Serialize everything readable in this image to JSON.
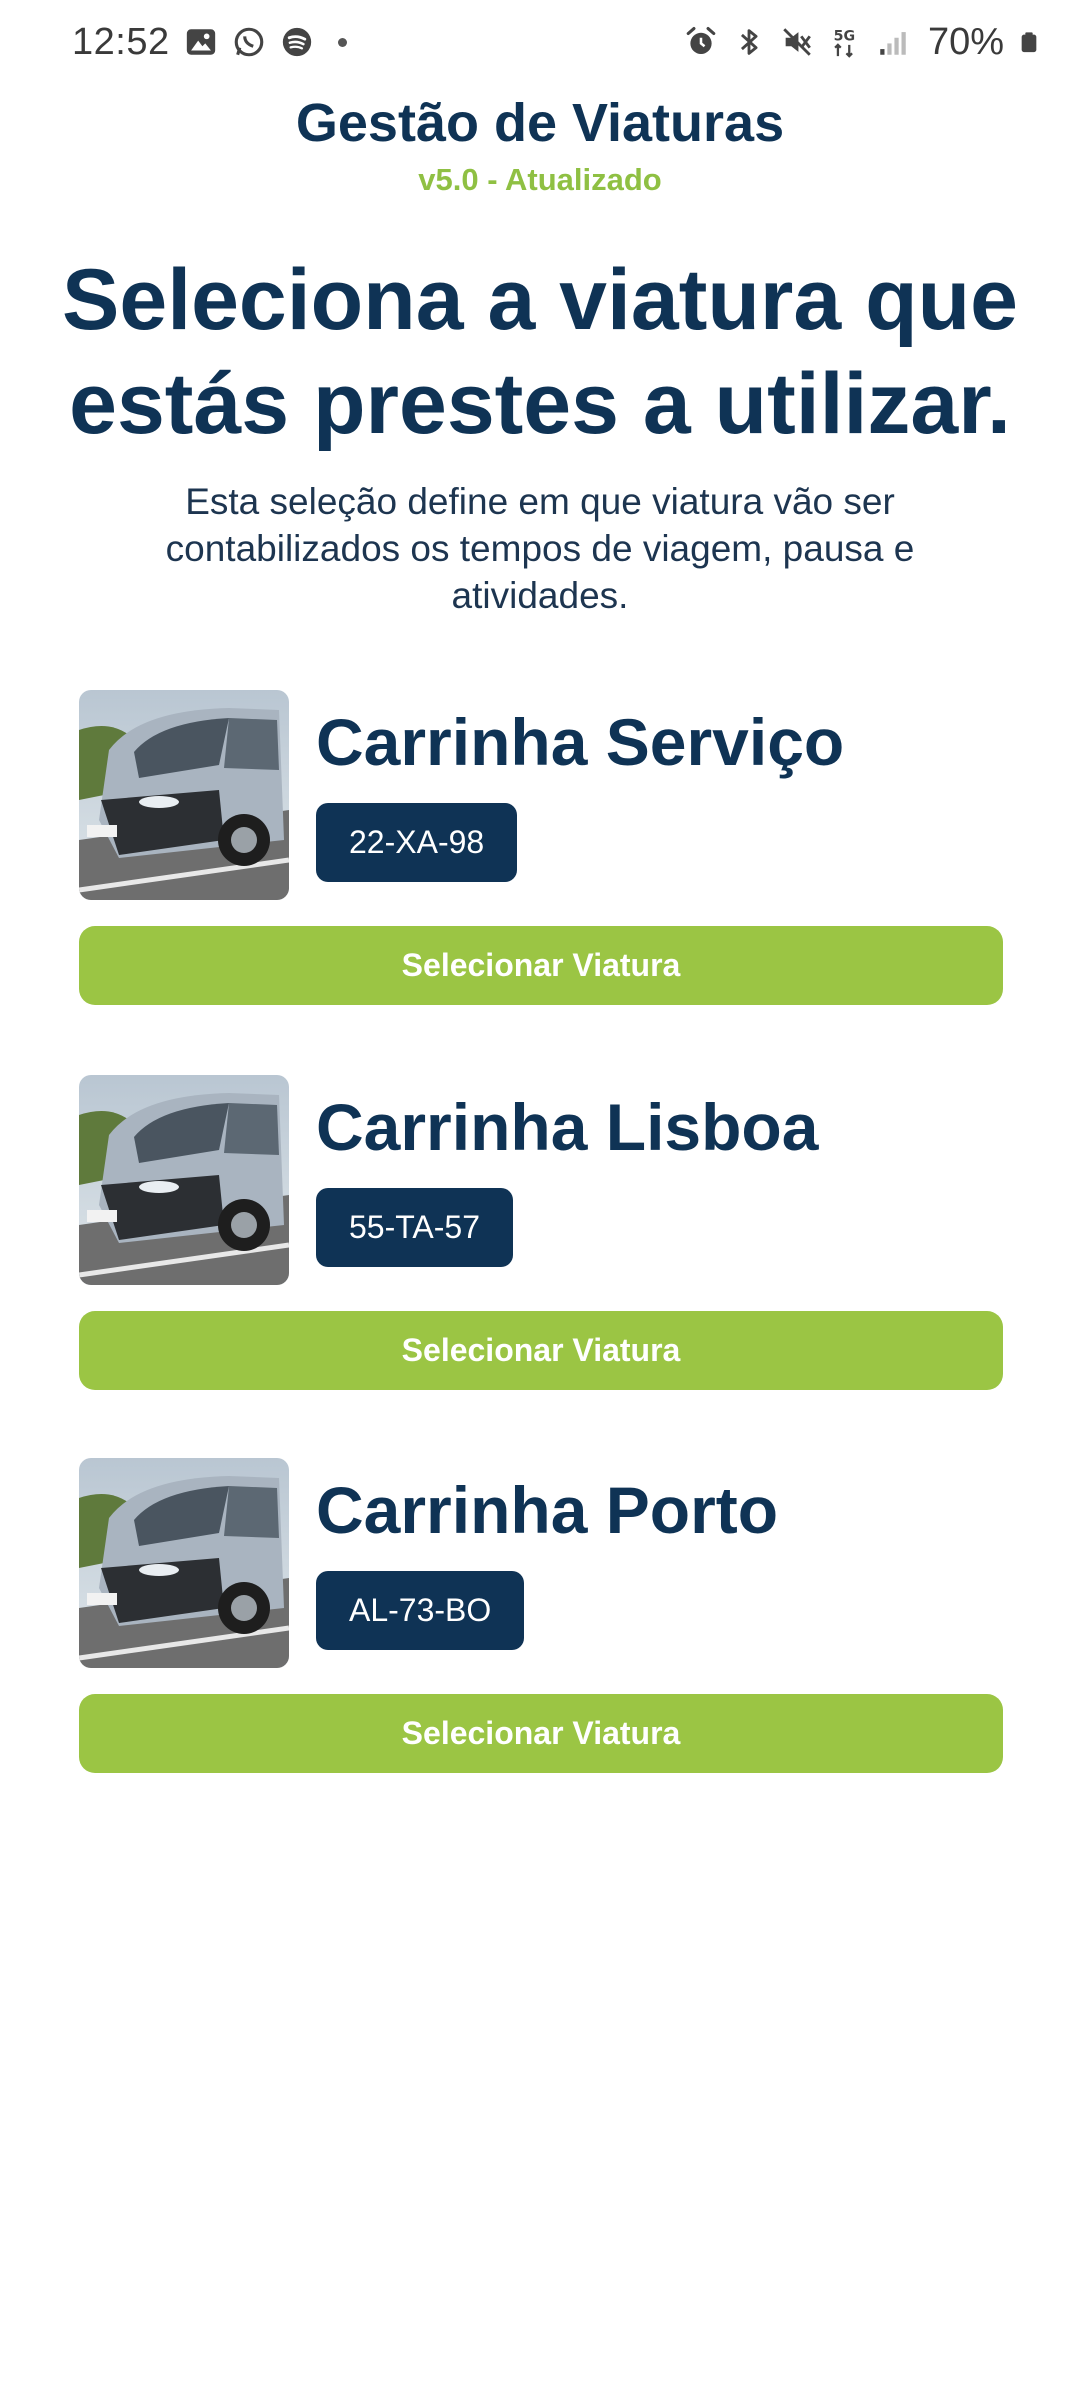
{
  "status_bar": {
    "time": "12:52",
    "battery": "70%",
    "icons": [
      "image-icon",
      "whatsapp-icon",
      "spotify-icon",
      "alarm-icon",
      "bluetooth-icon",
      "mute-icon",
      "5g-icon",
      "signal-icon",
      "battery-icon"
    ]
  },
  "header": {
    "title": "Gestão de Viaturas",
    "version": "v5.0 - Atualizado"
  },
  "headline": "Seleciona a viatura que estás prestes a utilizar.",
  "subtext": "Esta seleção define em que viatura vão ser contabilizados os tempos de viagem, pausa e atividades.",
  "vehicles": [
    {
      "name": "Carrinha Serviço",
      "plate": "22-XA-98",
      "button_label": "Selecionar Viatura"
    },
    {
      "name": "Carrinha Lisboa",
      "plate": "55-TA-57",
      "button_label": "Selecionar Viatura"
    },
    {
      "name": "Carrinha Porto",
      "plate": "AL-73-BO",
      "button_label": "Selecionar Viatura"
    }
  ],
  "colors": {
    "primary": "#0f3355",
    "accent": "#9bc544"
  }
}
